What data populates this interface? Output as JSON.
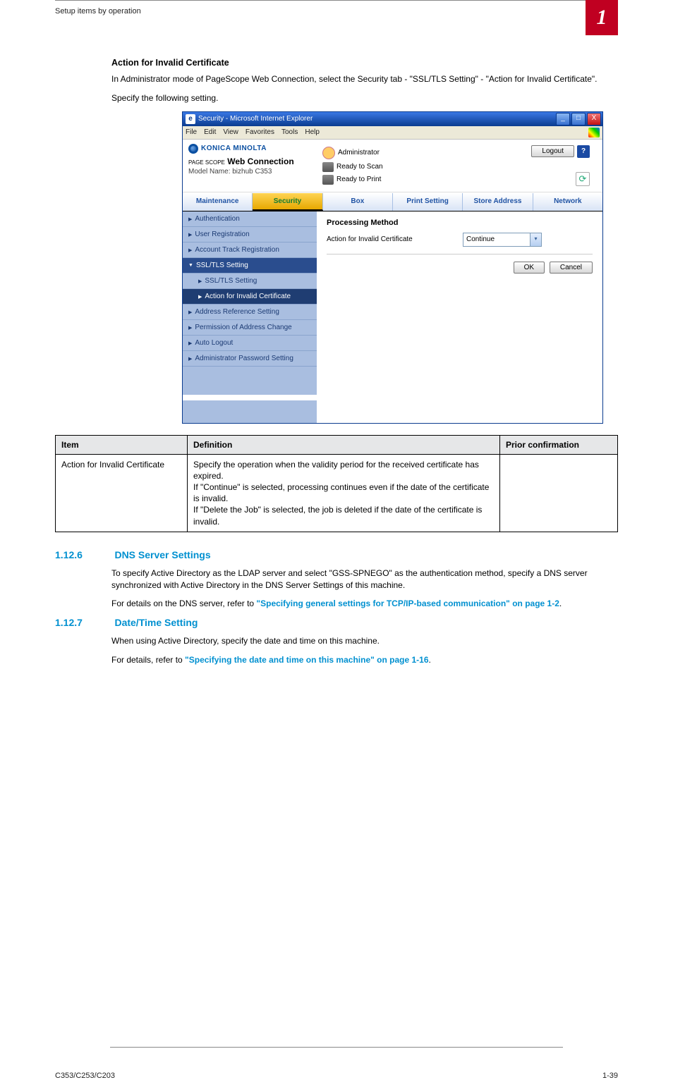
{
  "header": {
    "breadcrumb": "Setup items by operation",
    "chapter": "1"
  },
  "section_afc": {
    "title": "Action for Invalid Certificate",
    "para1": "In Administrator mode of PageScope Web Connection, select the Security tab - \"SSL/TLS Setting\" - \"Action for Invalid Certificate\".",
    "para2": "Specify the following setting."
  },
  "browser": {
    "title": "Security - Microsoft Internet Explorer",
    "menus": [
      "File",
      "Edit",
      "View",
      "Favorites",
      "Tools",
      "Help"
    ],
    "win_min": "_",
    "win_max": "□",
    "win_close": "X"
  },
  "brand": {
    "km": "KONICA MINOLTA",
    "ps_prefix": "PAGE SCOPE",
    "ps_title": "Web Connection",
    "model": "Model Name: bizhub C353",
    "admin": "Administrator",
    "ready_scan": "Ready to Scan",
    "ready_print": "Ready to Print",
    "logout": "Logout",
    "help": "?",
    "refresh": "⟳"
  },
  "tabs": [
    "Maintenance",
    "Security",
    "Box",
    "Print Setting",
    "Store Address",
    "Network"
  ],
  "sidebar": {
    "items": [
      {
        "label": "Authentication"
      },
      {
        "label": "User Registration"
      },
      {
        "label": "Account Track Registration"
      },
      {
        "label": "SSL/TLS Setting",
        "open": true,
        "children": [
          {
            "label": "SSL/TLS Setting"
          },
          {
            "label": "Action for Invalid Certificate",
            "active": true
          }
        ]
      },
      {
        "label": "Address Reference Setting"
      },
      {
        "label": "Permission of Address Change"
      },
      {
        "label": "Auto Logout"
      },
      {
        "label": "Administrator Password Setting"
      }
    ]
  },
  "mainpane": {
    "title": "Processing Method",
    "field_label": "Action for Invalid Certificate",
    "select_value": "Continue",
    "btn_ok": "OK",
    "btn_cancel": "Cancel"
  },
  "idp_table": {
    "headers": [
      "Item",
      "Definition",
      "Prior confirmation"
    ],
    "rows": [
      {
        "item": "Action for Invalid Certificate",
        "definition": "Specify the operation when the validity period for the received certificate has expired.\nIf \"Continue\" is selected, processing continues even if the date of the certificate is invalid.\nIf \"Delete the Job\" is selected, the job is deleted if the date of the certificate is invalid.",
        "prior": ""
      }
    ]
  },
  "sec_dns": {
    "num": "1.12.6",
    "title": "DNS Server Settings",
    "para1": "To specify Active Directory as the LDAP server and select \"GSS-SPNEGO\" as the authentication method, specify a DNS server synchronized with Active Directory in the DNS Server Settings of this machine.",
    "para2_a": "For details on the DNS server, refer to ",
    "para2_link": "\"Specifying general settings for TCP/IP-based communication\" on page 1-2",
    "para2_b": "."
  },
  "sec_dt": {
    "num": "1.12.7",
    "title": "Date/Time Setting",
    "para1": "When using Active Directory, specify the date and time on this machine.",
    "para2_a": "For details, refer to ",
    "para2_link": "\"Specifying the date and time on this machine\" on page 1-16",
    "para2_b": "."
  },
  "footer": {
    "left": "C353/C253/C203",
    "right": "1-39"
  }
}
